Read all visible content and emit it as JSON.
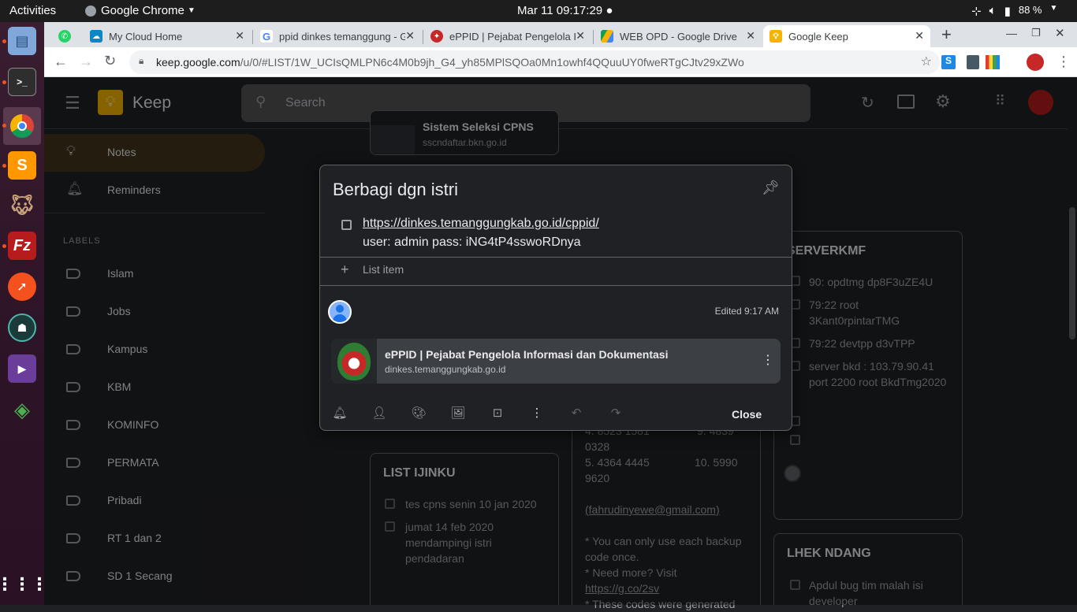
{
  "system": {
    "activities": "Activities",
    "app_menu": "Google Chrome",
    "clock": "Mar 11  09:17:29",
    "battery": "88 %"
  },
  "tabs": [
    {
      "label": "",
      "favicon": "whatsapp-icon"
    },
    {
      "label": "My Cloud Home",
      "favicon": "cloud-icon"
    },
    {
      "label": "ppid dinkes temanggung - G",
      "favicon": "google-icon"
    },
    {
      "label": "ePPID | Pejabat Pengelola In",
      "favicon": "eppid-icon"
    },
    {
      "label": "WEB OPD - Google Drive",
      "favicon": "drive-icon"
    },
    {
      "label": "Google Keep",
      "favicon": "keep-icon"
    }
  ],
  "url": {
    "host": "keep.google.com",
    "path": "/u/0/#LIST/1W_UCIsQMLPN6c4M0b9jh_G4_yh85MPlSQOa0Mn1owhf4QQuuUY0fweRTgCJtv29xZWo"
  },
  "keep": {
    "app_name": "Keep",
    "search_placeholder": "Search",
    "nav": [
      {
        "label": "Notes"
      },
      {
        "label": "Reminders"
      }
    ],
    "labels_heading": "LABELS",
    "labels": [
      "Islam",
      "Jobs",
      "Kampus",
      "KBM",
      "KOMINFO",
      "PERMATA",
      "Pribadi",
      "RT 1 dan 2",
      "SD 1 Secang"
    ]
  },
  "notes": {
    "partial_top": {
      "title": "Sistem Seleksi CPNS",
      "sub": "sscndaftar.bkn.go.id"
    },
    "serverkmf": {
      "title": "SERVERKMF",
      "items": [
        "90: opdtmg dp8F3uZE4U",
        "79:22 root 3Kant0rpintarTMG",
        "79:22 devtpp d3vTPP",
        "server bkd : 103.79.90.41 port 2200 root BkdTmg2020"
      ]
    },
    "backup_codes": {
      "lines": [
        "4. 8523 1581",
        "9. 4839",
        "0328",
        "5. 4364 4445",
        "10. 5990",
        "9620",
        "(fahrudinyewe@gmail.com)",
        "* You can only use each backup code once.",
        "* Need more? Visit",
        "https://g.co/2sv",
        "* These codes were generated"
      ]
    },
    "list_ijinku": {
      "title": "LIST IJINKU",
      "items": [
        "tes cpns senin 10 jan 2020",
        "jumat 14 feb 2020 mendampingi istri pendadaran"
      ]
    },
    "lhek_ndang": {
      "title": "LHEK NDANG",
      "items": [
        "Apdul bug tim malah isi developer"
      ]
    }
  },
  "dialog": {
    "title": "Berbagi dgn istri",
    "item_link": "https://dinkes.temanggungkab.go.id/cppid/",
    "item_text": "user: admin pass: iNG4tP4sswoRDnya",
    "add_item": "List item",
    "edited": "Edited 9:17 AM",
    "link_title": "ePPID | Pejabat Pengelola Informasi dan Dokumentasi",
    "link_domain": "dinkes.temanggungkab.go.id",
    "close": "Close"
  }
}
